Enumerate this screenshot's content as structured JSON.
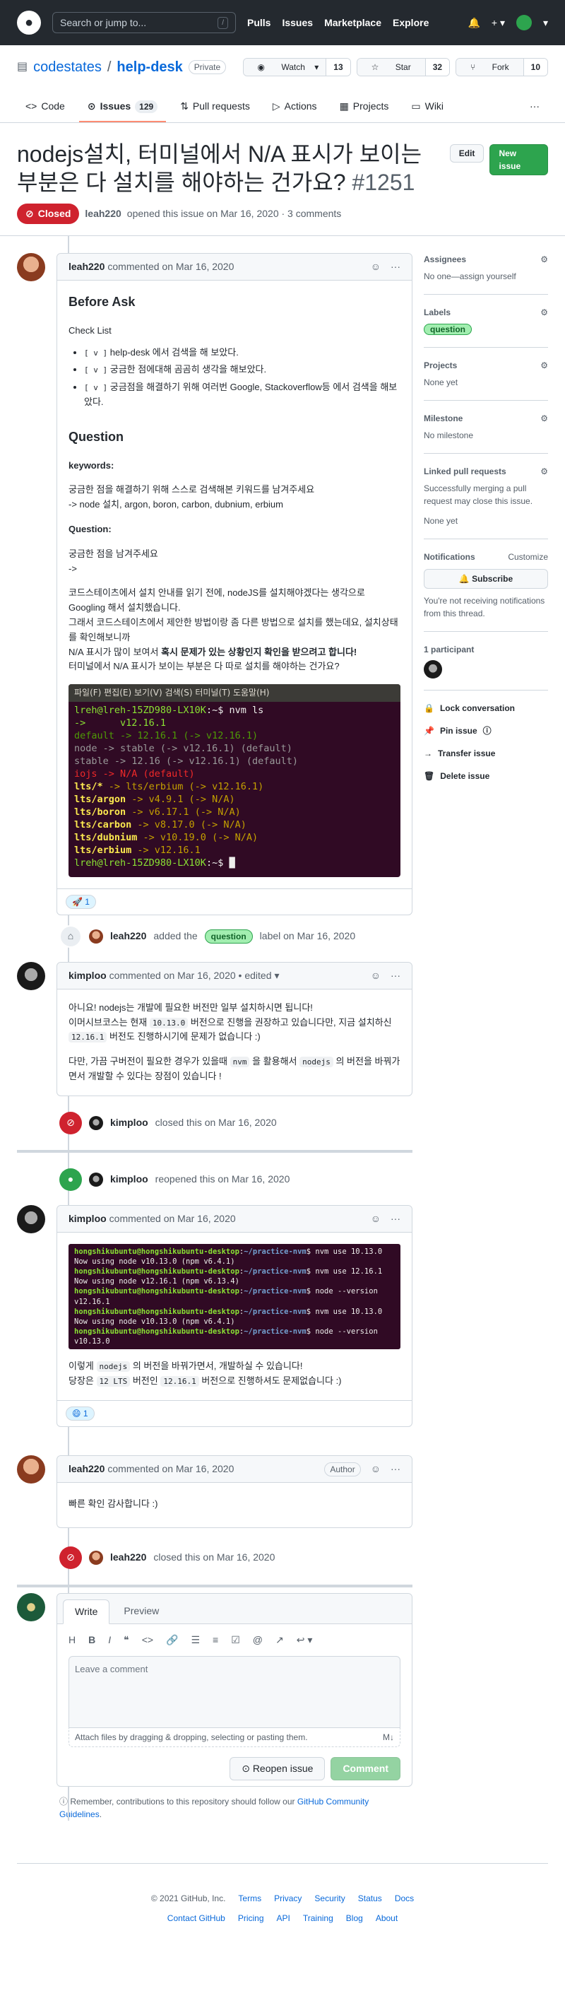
{
  "header": {
    "search_placeholder": "Search or jump to...",
    "search_shortcut": "/",
    "nav": [
      "Pulls",
      "Issues",
      "Marketplace",
      "Explore"
    ]
  },
  "repo": {
    "owner": "codestates",
    "separator": "/",
    "name": "help-desk",
    "visibility": "Private",
    "watch_label": "Watch",
    "watch_count": "13",
    "star_label": "Star",
    "star_count": "32",
    "fork_label": "Fork",
    "fork_count": "10",
    "tabs": [
      {
        "label": "Code"
      },
      {
        "label": "Issues",
        "count": "129"
      },
      {
        "label": "Pull requests"
      },
      {
        "label": "Actions"
      },
      {
        "label": "Projects"
      },
      {
        "label": "Wiki"
      }
    ]
  },
  "issue": {
    "title": "nodejs설치, 터미널에서 N/A 표시가 보이는 부분은 다 설치를 해야하는 건가요?",
    "number": "#1251",
    "edit_label": "Edit",
    "new_issue_label": "New issue",
    "state": "Closed",
    "author": "leah220",
    "meta": "opened this issue on Mar 16, 2020 · 3 comments"
  },
  "comment1": {
    "author": "leah220",
    "date": "commented on Mar 16, 2020",
    "h_before": "Before Ask",
    "checklist_title": "Check List",
    "checklist": [
      {
        "box": "[ v ]",
        "text": "help-desk 에서 검색을 해 보았다."
      },
      {
        "box": "[ v ]",
        "text": "궁금한 점에대해 곰곰히 생각을 해보았다."
      },
      {
        "box": "[ v ]",
        "text": "궁금점을 해결하기 위해 여러번 Google, Stackoverflow등 에서 검색을 해보았다."
      }
    ],
    "h_question": "Question",
    "keywords_title": "keywords:",
    "keywords_1": "궁금한 점을 해결하기 위해 스스로 검색해본 키워드를 남겨주세요",
    "keywords_2": "-> node 설치, argon, boron, carbon, dubnium, erbium",
    "question_title": "Question:",
    "question_1": "궁금한 점을 남겨주세요",
    "question_2": "->",
    "body_1": "코드스테이츠에서 설치 안내를 읽기 전에, nodeJS를 설치해야겠다는 생각으로 Googling 해서 설치했습니다.",
    "body_2": "그래서 코드스테이츠에서 제안한 방법이랑 좀 다른 방법으로 설치를 했는데요, 설치상태를 확인해보니까",
    "body_3a": "N/A 표시가 많이 보여서 ",
    "body_3b": "혹시 문제가 있는 상황인지 확인을 받으려고 합니다!",
    "body_4": "터미널에서 N/A 표시가 보이는 부분은 다 따로 설치를 해야하는 건가요?",
    "terminal_menu": "파일(F)  편집(E)  보기(V)  검색(S)  터미널(T)  도움말(H)",
    "reaction_emoji": "🚀",
    "reaction_count": "1"
  },
  "event_label": {
    "user": "leah220",
    "pre": "added the",
    "label": "question",
    "post": "label on Mar 16, 2020"
  },
  "comment2": {
    "author": "kimploo",
    "date": "commented on Mar 16, 2020 • edited",
    "p1": "아니요! nodejs는 개발에 필요한 버전만 일부 설치하시면 됩니다!",
    "p2a": "이머시브코스는 현재 ",
    "p2code": "10.13.0",
    "p2b": " 버전으로 진행을 권장하고 있습니다만, 지금 설치하신",
    "p3code": "12.16.1",
    "p3b": " 버전도 진행하시기에 문제가 없습니다 :)",
    "p4a": "다만, 가끔 구버전이 필요한 경우가 있을때 ",
    "p4code1": "nvm",
    "p4b": " 을 활용해서 ",
    "p4code2": "nodejs",
    "p4c": " 의 버전을 바꿔가면서 개발할 수 있다는 장점이 있습니다 !"
  },
  "event_closed1": {
    "user": "kimploo",
    "text": "closed this on Mar 16, 2020"
  },
  "event_reopen": {
    "user": "kimploo",
    "text": "reopened this on Mar 16, 2020"
  },
  "comment3": {
    "author": "kimploo",
    "date": "commented on Mar 16, 2020",
    "p1": "이렇게 nodejs 의 버전을 바꿔가면서, 개발하실 수 있습니다!",
    "p1a": "이렇게 ",
    "p1code": "nodejs",
    "p1b": " 의 버전을 바꿔가면서, 개발하실 수 있습니다!",
    "p2a": "당장은 ",
    "p2code1": "12 LTS",
    "p2b": " 버전인 ",
    "p2code2": "12.16.1",
    "p2c": " 버전으로 진행하셔도 문제없습니다 :)",
    "reaction_emoji": "😄",
    "reaction_count": "1"
  },
  "comment4": {
    "author": "leah220",
    "date": "commented on Mar 16, 2020",
    "badge": "Author",
    "body": "빠른 확인 감사합니다 :)"
  },
  "event_closed2": {
    "user": "leah220",
    "text": "closed this on Mar 16, 2020"
  },
  "new_comment": {
    "tab_write": "Write",
    "tab_preview": "Preview",
    "placeholder": "Leave a comment",
    "attach": "Attach files by dragging & dropping, selecting or pasting them.",
    "reopen_label": "Reopen issue",
    "comment_label": "Comment",
    "note_pre": "Remember, contributions to this repository should follow our ",
    "note_link": "GitHub Community Guidelines",
    "note_post": "."
  },
  "sidebar": {
    "assignees_title": "Assignees",
    "assignees_val": "No one—assign yourself",
    "labels_title": "Labels",
    "label": "question",
    "projects_title": "Projects",
    "projects_val": "None yet",
    "milestone_title": "Milestone",
    "milestone_val": "No milestone",
    "linked_title": "Linked pull requests",
    "linked_desc": "Successfully merging a pull request may close this issue.",
    "linked_val": "None yet",
    "notif_title": "Notifications",
    "notif_customize": "Customize",
    "subscribe": "Subscribe",
    "notif_desc": "You're not receiving notifications from this thread.",
    "participants": "1 participant",
    "lock": "Lock conversation",
    "pin": "Pin issue",
    "transfer": "Transfer issue",
    "delete": "Delete issue"
  },
  "footer": {
    "copyright": "© 2021 GitHub, Inc.",
    "row1": [
      "Terms",
      "Privacy",
      "Security",
      "Status",
      "Docs"
    ],
    "row2": [
      "Contact GitHub",
      "Pricing",
      "API",
      "Training",
      "Blog",
      "About"
    ]
  },
  "colors": {
    "accent": "#0969da",
    "closed": "#cf222e",
    "green": "#2da44e",
    "terminal_bg": "#300a24"
  }
}
